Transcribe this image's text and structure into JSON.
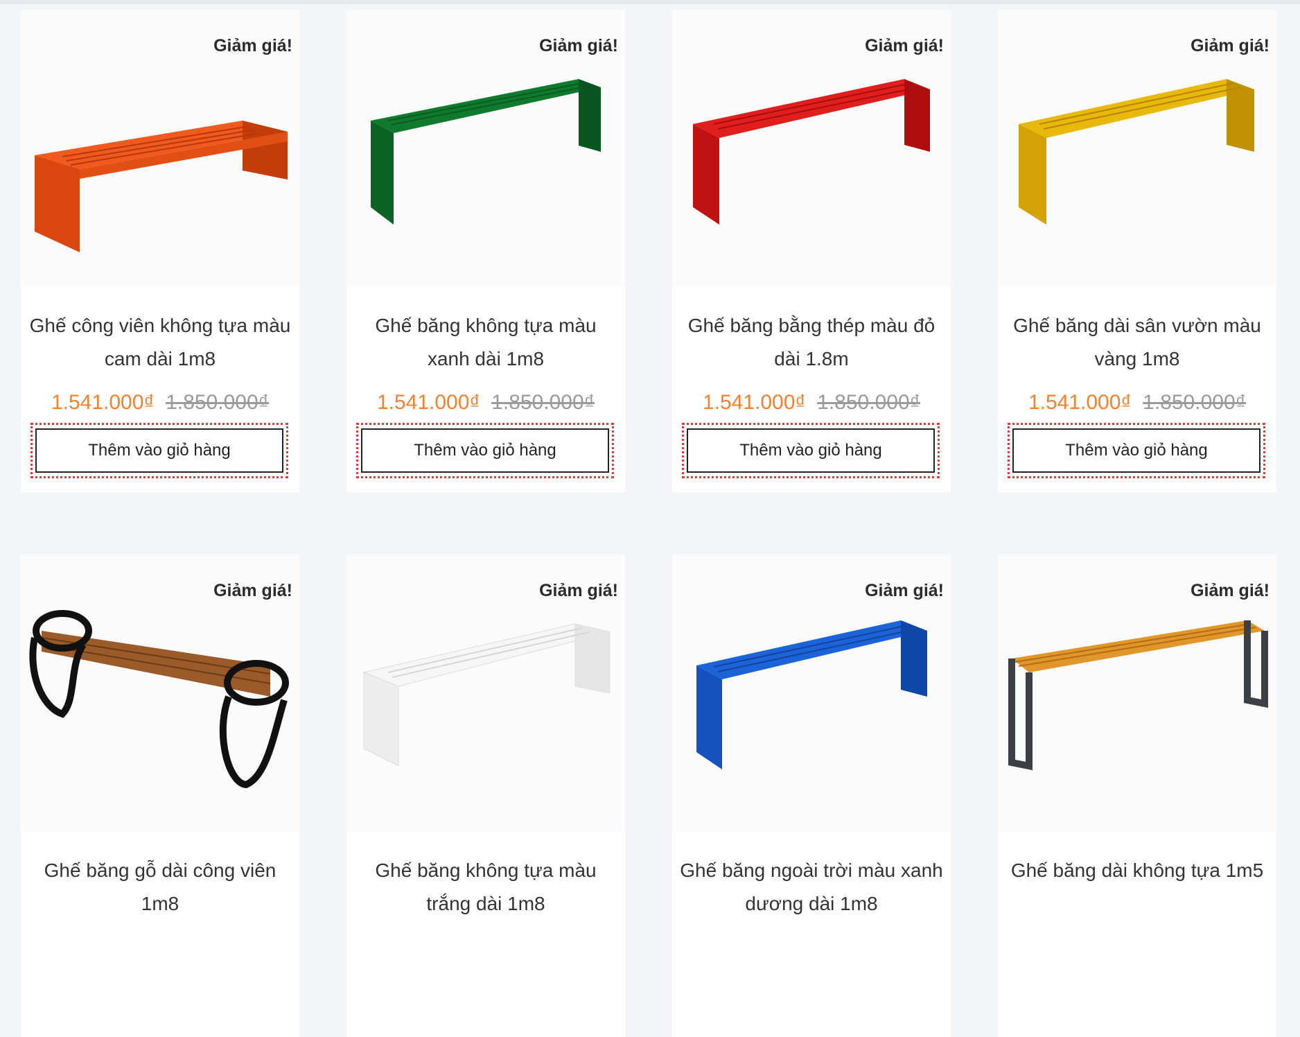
{
  "products": [
    {
      "badge": "Giảm giá!",
      "title": "Ghế công viên không tựa màu cam dài 1m8",
      "price_new": "1.541.000₫",
      "price_old": "1.850.000₫",
      "cart_label": "Thêm vào giỏ hàng",
      "color": "#f05a1e"
    },
    {
      "badge": "Giảm giá!",
      "title": "Ghế băng không tựa màu xanh dài 1m8",
      "price_new": "1.541.000₫",
      "price_old": "1.850.000₫",
      "cart_label": "Thêm vào giỏ hàng",
      "color": "#0f7a2e"
    },
    {
      "badge": "Giảm giá!",
      "title": "Ghế băng bằng thép màu đỏ dài 1.8m",
      "price_new": "1.541.000₫",
      "price_old": "1.850.000₫",
      "cart_label": "Thêm vào giỏ hàng",
      "color": "#e01e1e"
    },
    {
      "badge": "Giảm giá!",
      "title": "Ghế băng dài sân vườn màu vàng 1m8",
      "price_new": "1.541.000₫",
      "price_old": "1.850.000₫",
      "cart_label": "Thêm vào giỏ hàng",
      "color": "#e8b80a"
    },
    {
      "badge": "Giảm giá!",
      "title": "Ghế băng gỗ dài công viên 1m8",
      "color": "#9a5a2a"
    },
    {
      "badge": "Giảm giá!",
      "title": "Ghế băng không tựa màu trắng dài 1m8",
      "color": "#f2f2f2"
    },
    {
      "badge": "Giảm giá!",
      "title": "Ghế băng ngoài trời màu xanh dương dài 1m8",
      "color": "#1c63d8"
    },
    {
      "badge": "Giảm giá!",
      "title": "Ghế băng dài không tựa 1m5",
      "color": "#e0962a"
    }
  ]
}
